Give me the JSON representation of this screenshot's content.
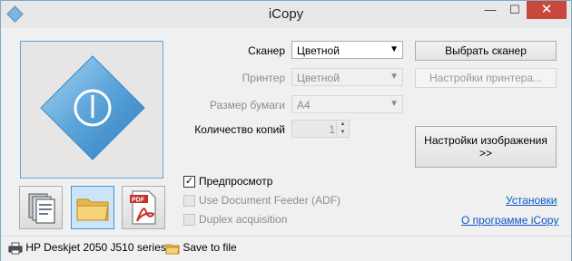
{
  "window": {
    "title": "iCopy"
  },
  "titlebar": {
    "minimize_glyph": "—",
    "maximize_glyph": "☐",
    "close_glyph": "✕"
  },
  "settings": {
    "scanner_label": "Сканер",
    "scanner_value": "Цветной",
    "printer_label": "Принтер",
    "printer_value": "Цветной",
    "paper_label": "Размер бумаги",
    "paper_value": "A4",
    "copies_label": "Количество копий",
    "copies_value": "1"
  },
  "buttons": {
    "select_scanner": "Выбрать сканер",
    "printer_settings": "Настройки принтера...",
    "image_settings_line1": "Настройки изображения",
    "image_settings_line2": ">>"
  },
  "options": {
    "preview_label": "Предпросмотр",
    "preview_checked": true,
    "adf_label": "Use Document Feeder (ADF)",
    "duplex_label": "Duplex acquisition"
  },
  "links": {
    "settings": "Установки",
    "about": "О программе iCopy"
  },
  "modes": [
    {
      "name": "copy-mode",
      "icon": "copy-stack-icon"
    },
    {
      "name": "save-mode",
      "icon": "folder-icon",
      "active": true
    },
    {
      "name": "pdf-mode",
      "icon": "pdf-icon"
    }
  ],
  "statusbar": {
    "printer_name": "HP Deskjet 2050 J510 series",
    "save_to_file": "Save to file"
  },
  "colors": {
    "accent": "#5ba3d9",
    "link": "#0b57c4",
    "close": "#c7483c"
  }
}
